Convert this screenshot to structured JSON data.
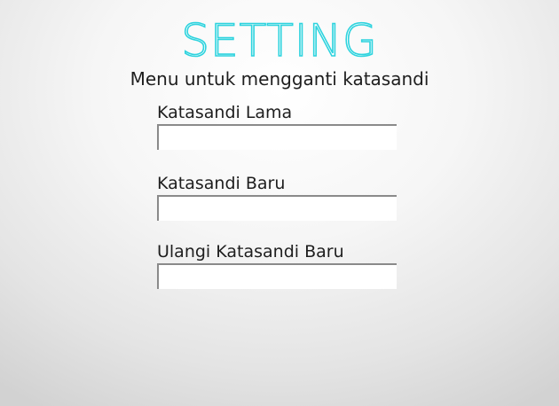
{
  "header": {
    "title": "SETTING",
    "subtitle": "Menu untuk mengganti katasandi"
  },
  "form": {
    "fields": [
      {
        "label": "Katasandi Lama",
        "value": "",
        "placeholder": ""
      },
      {
        "label": "Katasandi Baru",
        "value": "",
        "placeholder": ""
      },
      {
        "label": "Ulangi Katasandi Baru",
        "value": "",
        "placeholder": ""
      }
    ]
  },
  "colors": {
    "title_accent": "#2ed3de",
    "text": "#1e1e1e",
    "input_border": "#8a8a8a"
  }
}
